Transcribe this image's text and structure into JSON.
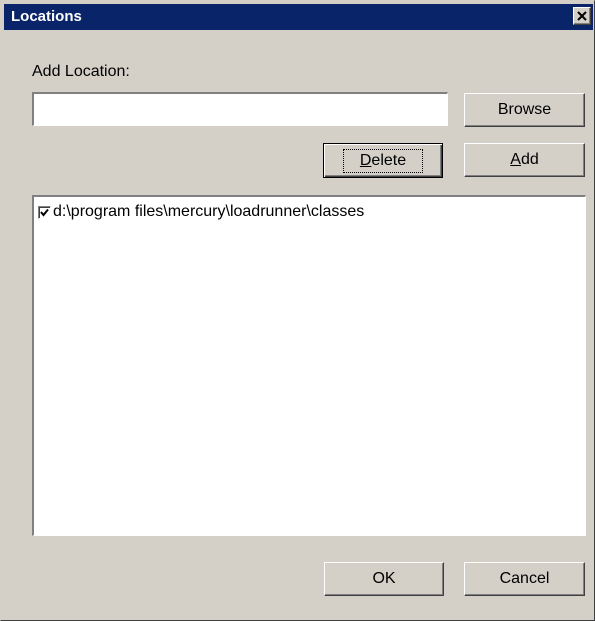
{
  "window": {
    "title": "Locations"
  },
  "close_icon": "close-icon",
  "form": {
    "add_location_label": "Add Location:",
    "add_location_value": "",
    "browse_label": "Browse",
    "delete_label_prefix": "",
    "delete_label_mnemonic": "D",
    "delete_label_rest": "elete",
    "add_label_mnemonic": "A",
    "add_label_rest": "dd"
  },
  "list": {
    "items": [
      {
        "checked": true,
        "text": "d:\\program files\\mercury\\loadrunner\\classes"
      }
    ]
  },
  "footer": {
    "ok_label": "OK",
    "cancel_label": "Cancel"
  }
}
